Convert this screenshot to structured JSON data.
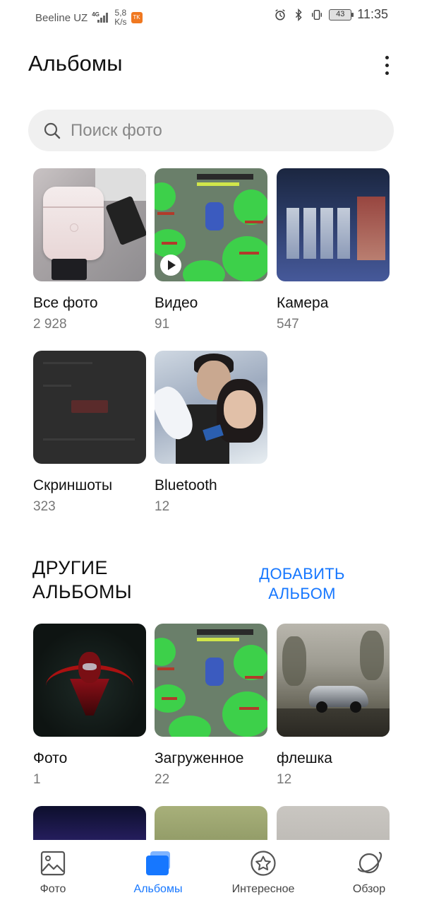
{
  "status_bar": {
    "carrier": "Beeline UZ",
    "network": "4G",
    "speed_value": "5,8",
    "speed_unit": "K/s",
    "battery": "43",
    "time": "11:35"
  },
  "header": {
    "title": "Альбомы"
  },
  "search": {
    "placeholder": "Поиск фото"
  },
  "albums": [
    {
      "name": "Все фото",
      "count": "2 928"
    },
    {
      "name": "Видео",
      "count": "91"
    },
    {
      "name": "Камера",
      "count": "547"
    },
    {
      "name": "Скриншоты",
      "count": "323"
    },
    {
      "name": "Bluetooth",
      "count": "12"
    }
  ],
  "other_section": {
    "title": "ДРУГИЕ АЛЬБОМЫ",
    "add_label": "ДОБАВИТЬ АЛЬБОМ"
  },
  "other_albums": [
    {
      "name": "Фото",
      "count": "1"
    },
    {
      "name": "Загруженное",
      "count": "22"
    },
    {
      "name": "флешка",
      "count": "12"
    }
  ],
  "bottom_nav": [
    {
      "label": "Фото",
      "icon": "photo-icon"
    },
    {
      "label": "Альбомы",
      "icon": "albums-icon",
      "active": true
    },
    {
      "label": "Интересное",
      "icon": "star-icon"
    },
    {
      "label": "Обзор",
      "icon": "discover-icon"
    }
  ],
  "colors": {
    "accent": "#1677ff",
    "search_bg": "#f0f0f0",
    "text_secondary": "#777777"
  }
}
